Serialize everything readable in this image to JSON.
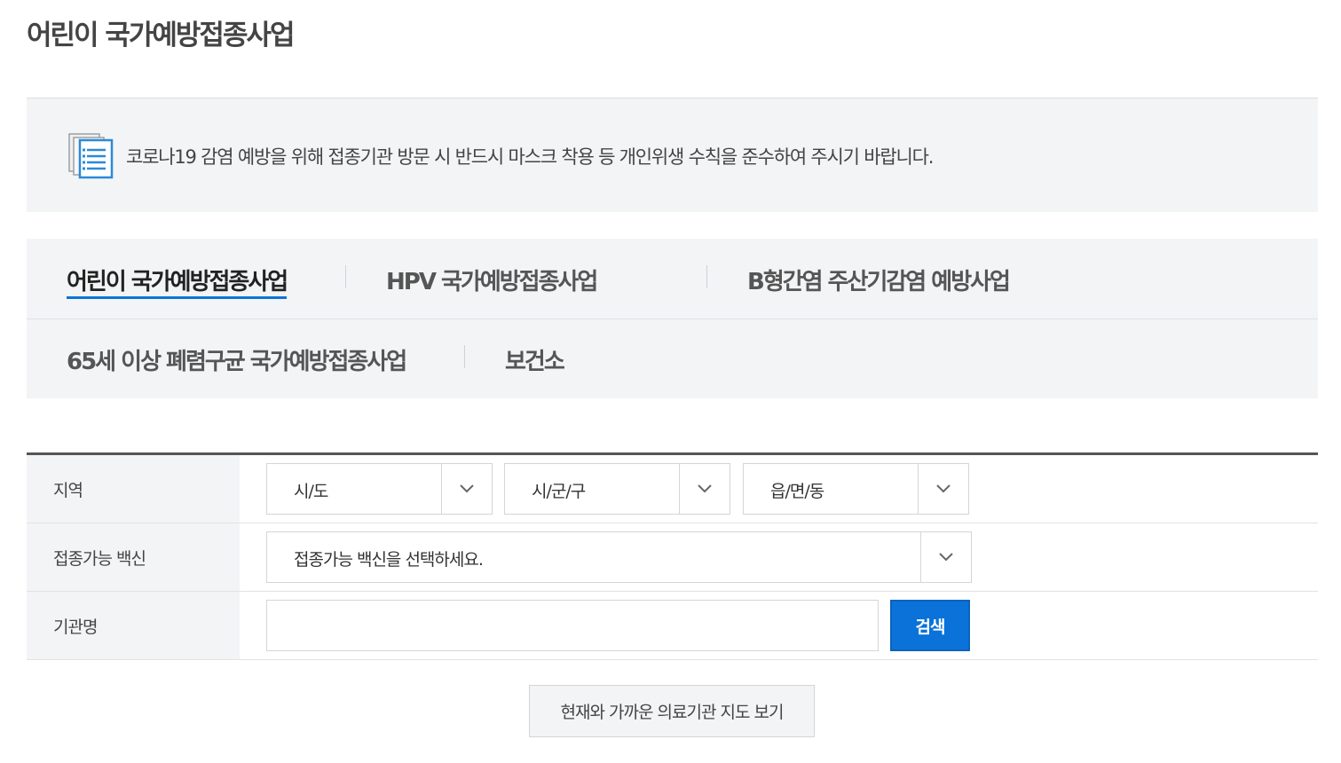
{
  "page": {
    "title": "어린이 국가예방접종사업"
  },
  "notice": {
    "icon": "document-list-icon",
    "text": "코로나19 감염 예방을 위해 접종기관 방문 시 반드시 마스크 착용 등 개인위생 수칙을 준수하여 주시기 바랍니다."
  },
  "tabs": [
    {
      "label": "어린이 국가예방접종사업",
      "active": true
    },
    {
      "label": "HPV 국가예방접종사업",
      "active": false
    },
    {
      "label": "B형간염 주산기감염 예방사업",
      "active": false
    },
    {
      "label": "65세 이상 폐렴구균 국가예방접종사업",
      "active": false
    },
    {
      "label": "보건소",
      "active": false
    }
  ],
  "search": {
    "region": {
      "label": "지역",
      "sido": "시/도",
      "sigungu": "시/군/구",
      "eupmyeondong": "읍/면/동"
    },
    "vaccine": {
      "label": "접종가능 백신",
      "placeholder": "접종가능 백신을 선택하세요."
    },
    "institution": {
      "label": "기관명",
      "value": "",
      "button": "검색"
    }
  },
  "map_button": "현재와 가까운 의료기관 지도 보기",
  "colors": {
    "accent": "#0a72d8",
    "panel_bg": "#f3f4f6",
    "border": "#d3d5d8"
  }
}
